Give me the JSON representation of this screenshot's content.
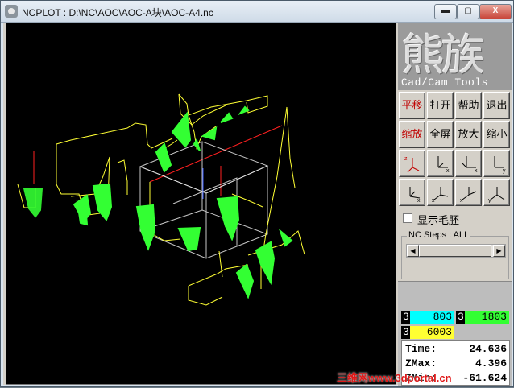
{
  "window": {
    "title": "NCPLOT : D:\\NC\\AOC\\AOC-A块\\AOC-A4.nc",
    "controls": [
      "▬",
      "▢",
      "X"
    ]
  },
  "logo": {
    "chinese": "熊族",
    "english": "Cad/Cam Tools"
  },
  "buttons": {
    "pan": "平移",
    "open": "打开",
    "help": "帮助",
    "exit": "退出",
    "zoom": "缩放",
    "fullscreen": "全屏",
    "zoom_in": "放大",
    "zoom_out": "缩小"
  },
  "view_buttons": [
    "view-zxy",
    "view-zx-iso",
    "view-yx",
    "view-xy",
    "view-zx",
    "view-xz",
    "view-xy-2",
    "view-yz"
  ],
  "checkbox": {
    "label": "显示毛胚",
    "checked": false
  },
  "nc_steps": {
    "label": "NC Steps : ALL"
  },
  "counters": [
    {
      "index": "3",
      "value": "803",
      "color": "#00ffff"
    },
    {
      "index": "3",
      "value": "1803",
      "color": "#00ff00"
    },
    {
      "index": "3",
      "value": "6003",
      "color": "#ffff00"
    }
  ],
  "stats": [
    {
      "label": "Time:",
      "value": "24.636"
    },
    {
      "label": "ZMax:",
      "value": "4.396"
    },
    {
      "label": "ZMin:",
      "value": "-61.624"
    }
  ],
  "watermark": "三维网www.3dportal.cn",
  "colors": {
    "toolpath_rapid": "#ffff33",
    "toolpath_cut": "#33ff33",
    "stock_box": "#c8c8c8",
    "axis_x": "#ff2020",
    "axis_y": "#3a5cff"
  }
}
